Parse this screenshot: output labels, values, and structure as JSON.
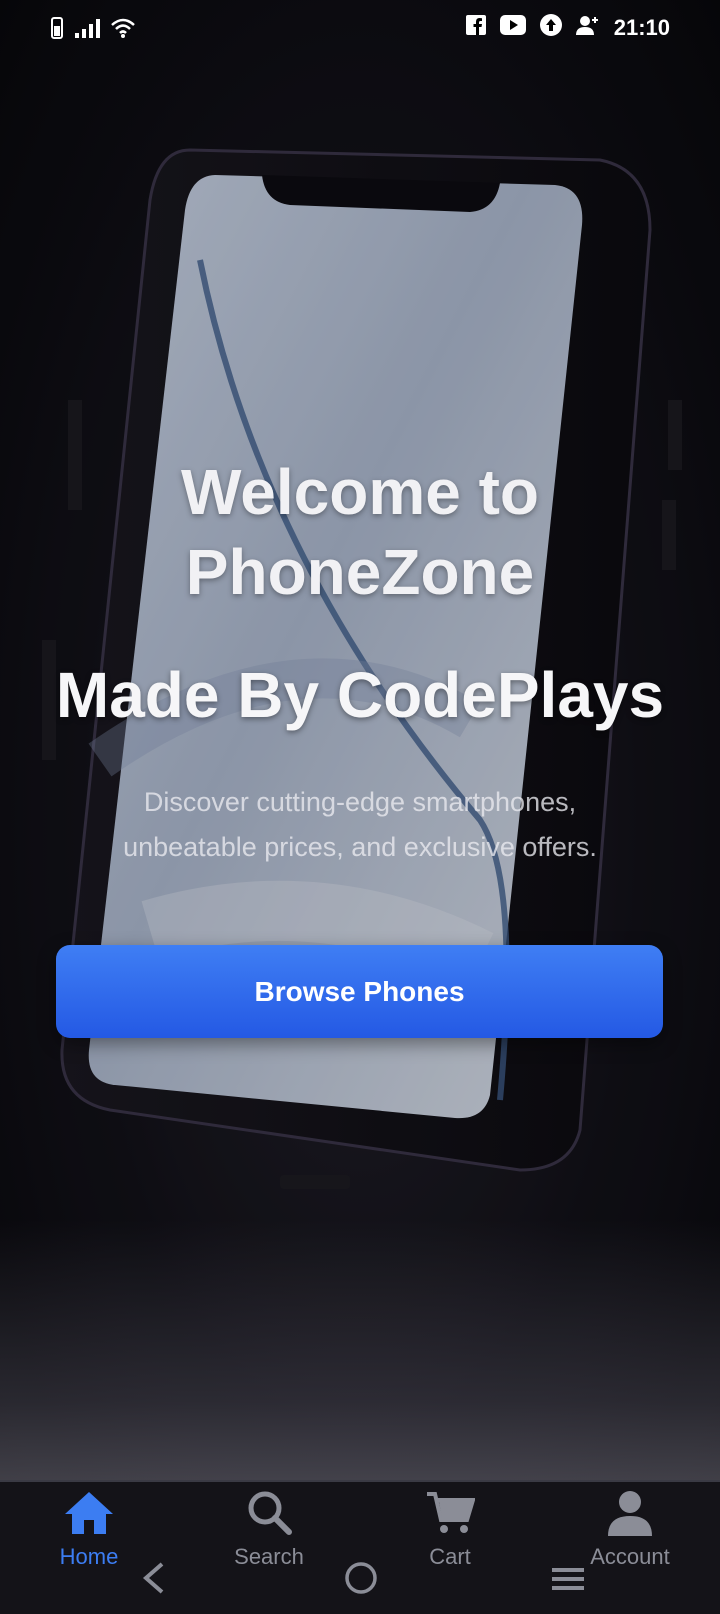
{
  "status_bar": {
    "time": "21:10"
  },
  "hero": {
    "headline_line1": "Welcome to",
    "headline_line2": "PhoneZone",
    "subheadline": "Made By CodePlays",
    "tagline": "Discover cutting-edge smartphones, unbeatable prices, and exclusive offers.",
    "cta_label": "Browse Phones"
  },
  "colors": {
    "accent": "#2f6bea",
    "nav_active": "#3c7df2",
    "nav_inactive": "#8b8d97"
  },
  "bottom_nav": {
    "items": [
      {
        "label": "Home",
        "icon": "home-icon",
        "active": true
      },
      {
        "label": "Search",
        "icon": "search-icon",
        "active": false
      },
      {
        "label": "Cart",
        "icon": "cart-icon",
        "active": false
      },
      {
        "label": "Account",
        "icon": "account-icon",
        "active": false
      }
    ]
  }
}
